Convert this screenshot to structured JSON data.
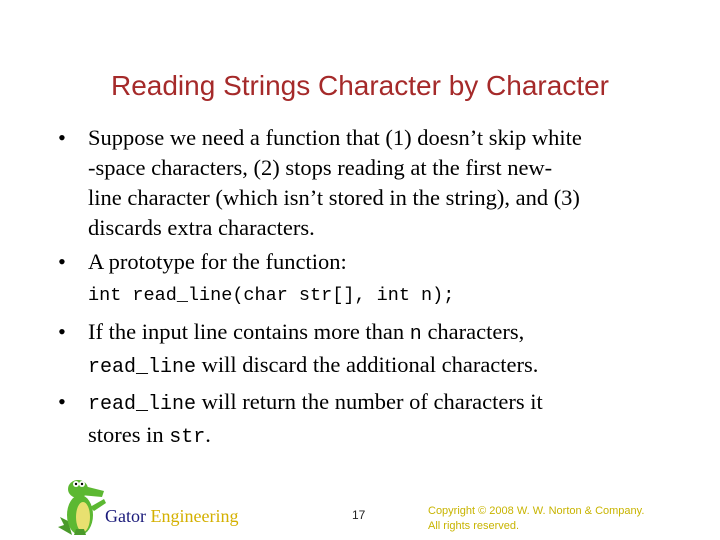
{
  "title": "Reading Strings Character by Character",
  "bullets": [
    {
      "lines": [
        "Suppose we need a function that (1) doesn’t skip white",
        "-space characters, (2) stops reading at the first new-",
        "line character (which isn’t stored in the string), and (3)",
        "discards extra characters."
      ]
    },
    {
      "text": "A prototype for the function:"
    }
  ],
  "prototype": "int read_line(char str[], int n);",
  "bullet3": {
    "part1": "If the input line contains more than ",
    "code1": "n",
    "part2": " characters,",
    "code2": "read_line",
    "part3": " will discard the additional characters."
  },
  "bullet4": {
    "code1": "read_line",
    "part1": " will return the number of characters it",
    "part2": "stores in ",
    "code2": "str",
    "part3": "."
  },
  "bullet_glyph": "•",
  "footer": {
    "brand_part1": "Gator",
    "brand_part2": "Engineering",
    "page_number": "17",
    "copyright_line1": "Copyright © 2008 W. W. Norton & Company.",
    "copyright_line2": "All rights reserved."
  },
  "colors": {
    "title": "#a52a2a",
    "brand_gator": "#1a1a7a",
    "brand_engineering": "#d4b000",
    "copyright": "#c8b400"
  }
}
